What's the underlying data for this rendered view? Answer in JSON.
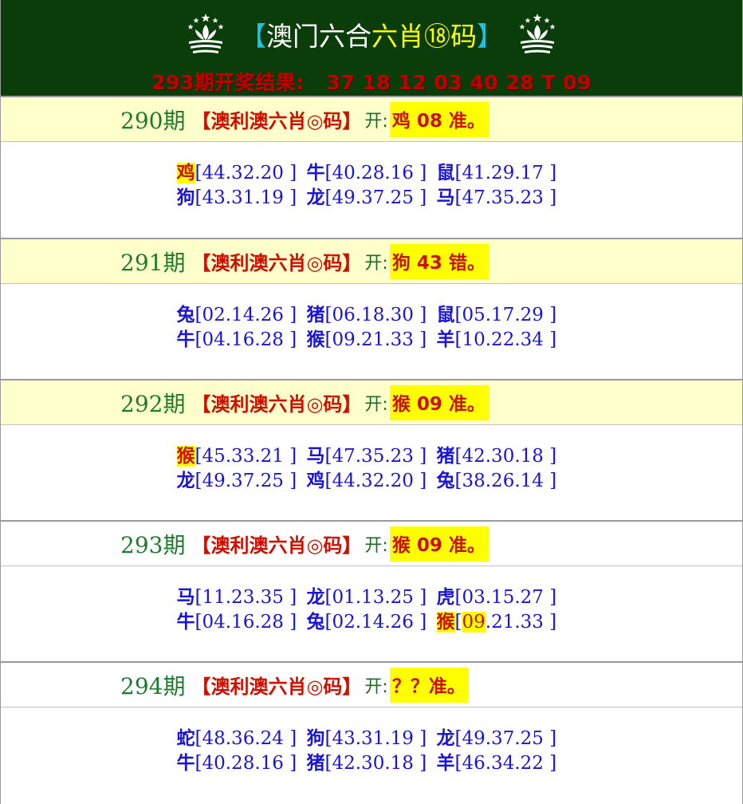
{
  "header": {
    "title_open": "【",
    "title_a": "澳门六合",
    "title_b": "六肖⑱码",
    "title_close": "】",
    "result_label": "293期开奖结果:",
    "result_numbers": "37 18 12 03 40 28 T 09"
  },
  "sections": [
    {
      "period": "290期",
      "tag": "【澳利澳六肖◎码】",
      "open_label": "开:",
      "result": "鸡 08 准。",
      "rows": [
        [
          {
            "z": "鸡",
            "n": "44.32.20",
            "zmark": true
          },
          {
            "z": "牛",
            "n": "40.28.16"
          },
          {
            "z": "鼠",
            "n": "41.29.17"
          }
        ],
        [
          {
            "z": "狗",
            "n": "43.31.19"
          },
          {
            "z": "龙",
            "n": "49.37.25"
          },
          {
            "z": "马",
            "n": "47.35.23"
          }
        ]
      ]
    },
    {
      "period": "291期",
      "tag": "【澳利澳六肖◎码】",
      "open_label": "开:",
      "result": "狗 43 错。",
      "rows": [
        [
          {
            "z": "兔",
            "n": "02.14.26"
          },
          {
            "z": "猪",
            "n": "06.18.30"
          },
          {
            "z": "鼠",
            "n": "05.17.29"
          }
        ],
        [
          {
            "z": "牛",
            "n": "04.16.28"
          },
          {
            "z": "猴",
            "n": "09.21.33"
          },
          {
            "z": "羊",
            "n": "10.22.34"
          }
        ]
      ]
    },
    {
      "period": "292期",
      "tag": "【澳利澳六肖◎码】",
      "open_label": "开:",
      "result": "猴 09 准。",
      "rows": [
        [
          {
            "z": "猴",
            "n": "45.33.21",
            "zmark": true
          },
          {
            "z": "马",
            "n": "47.35.23"
          },
          {
            "z": "猪",
            "n": "42.30.18"
          }
        ],
        [
          {
            "z": "龙",
            "n": "49.37.25"
          },
          {
            "z": "鸡",
            "n": "44.32.20"
          },
          {
            "z": "兔",
            "n": "38.26.14"
          }
        ]
      ]
    },
    {
      "period": "293期",
      "tag": "【澳利澳六肖◎码】",
      "open_label": "开:",
      "result": "猴 09 准。",
      "rows": [
        [
          {
            "z": "马",
            "n": "11.23.35"
          },
          {
            "z": "龙",
            "n": "01.13.25"
          },
          {
            "z": "虎",
            "n": "03.15.27"
          }
        ],
        [
          {
            "z": "牛",
            "n": "04.16.28"
          },
          {
            "z": "兔",
            "n": "02.14.26"
          },
          {
            "z": "猴",
            "n": "09",
            "n2": ".21.33",
            "zmark": true,
            "nmark": true
          }
        ]
      ]
    },
    {
      "period": "294期",
      "tag": "【澳利澳六肖◎码】",
      "open_label": "开:",
      "result": "？？准。",
      "rows": [
        [
          {
            "z": "蛇",
            "n": "48.36.24"
          },
          {
            "z": "狗",
            "n": "43.31.19"
          },
          {
            "z": "龙",
            "n": "49.37.25"
          }
        ],
        [
          {
            "z": "牛",
            "n": "40.28.16"
          },
          {
            "z": "猪",
            "n": "42.30.18"
          },
          {
            "z": "羊",
            "n": "46.34.22"
          }
        ]
      ]
    }
  ]
}
